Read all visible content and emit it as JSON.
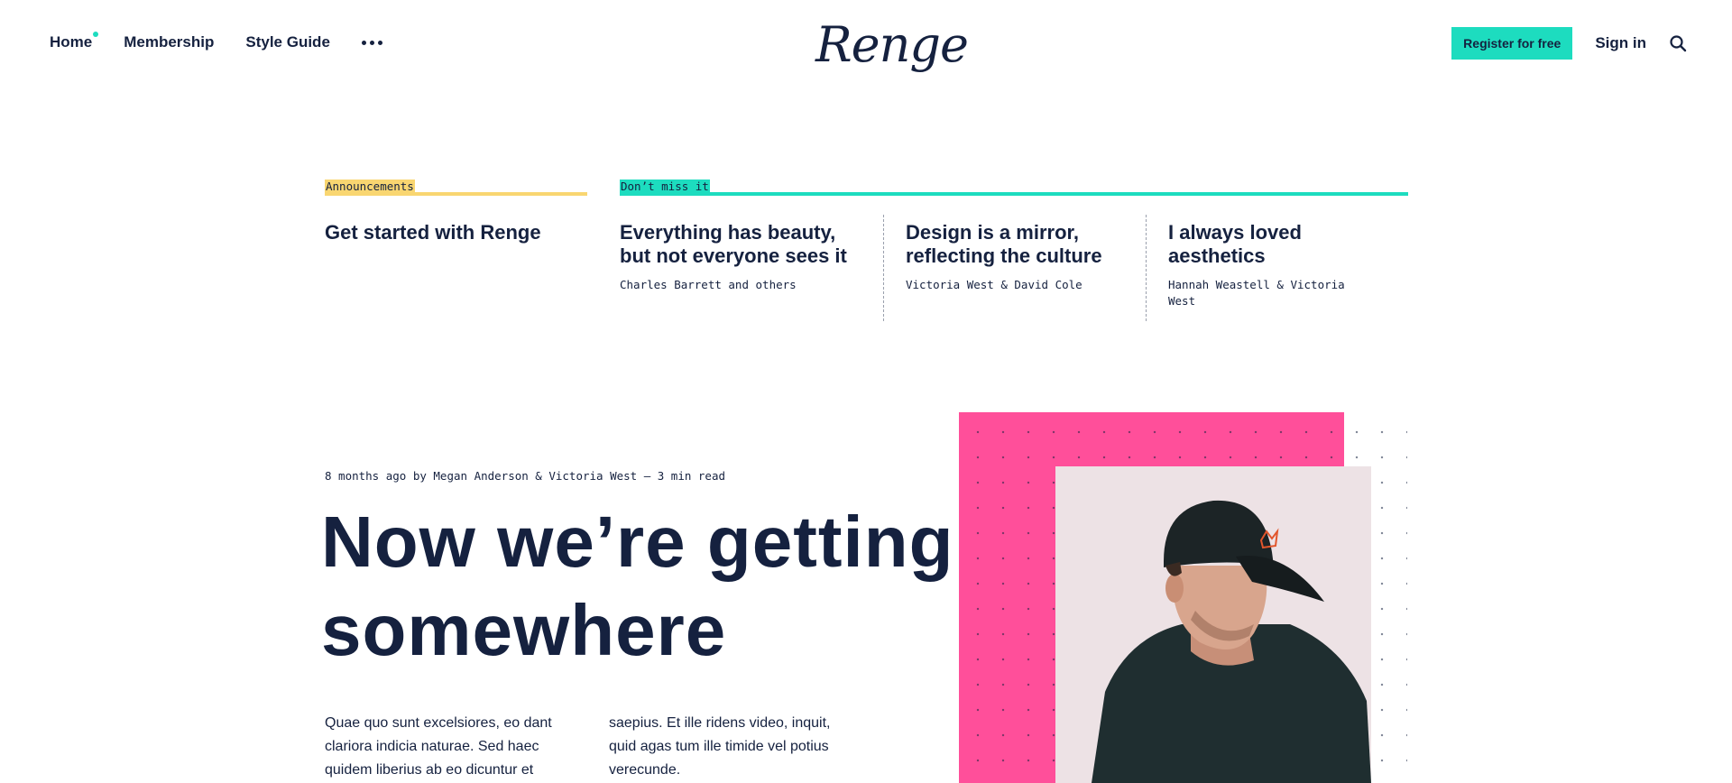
{
  "nav": {
    "items": [
      {
        "label": "Home"
      },
      {
        "label": "Membership"
      },
      {
        "label": "Style Guide"
      }
    ]
  },
  "logo": {
    "text": "Renge"
  },
  "actions": {
    "register_label": "Register for free",
    "signin_label": "Sign in"
  },
  "featured": {
    "announcements_label": "Announcements",
    "dontmiss_label": "Don’t miss it",
    "announcement": {
      "title": "Get started with Renge"
    },
    "cards": [
      {
        "title": "Everything has beauty, but not everyone sees it",
        "author": "Charles Barrett and others"
      },
      {
        "title": "Design is a mirror, reflecting the culture",
        "author": "Victoria West & David Cole"
      },
      {
        "title": "I always loved aesthetics",
        "author": "Hannah Weastell & Victoria West"
      }
    ]
  },
  "hero": {
    "meta": "8 months ago by Megan Anderson & Victoria West — 3 min read",
    "title_line1": "Now we’re getting",
    "title_line2": "somewhere",
    "excerpt_col1": "Quae quo sunt excelsiores, eo dant clariora indicia naturae. Sed haec quidem liberius ab eo dicuntur et",
    "excerpt_col2": "saepius. Et ille ridens video, inquit, quid agas tum ille timide vel potius verecunde."
  },
  "colors": {
    "navy": "#15213f",
    "accent_teal": "#1ddcbf",
    "accent_yellow": "#f9d671",
    "hero_pink": "#ff4f9a"
  },
  "icons": {
    "search": "search-icon",
    "more": "more-dots-icon"
  }
}
